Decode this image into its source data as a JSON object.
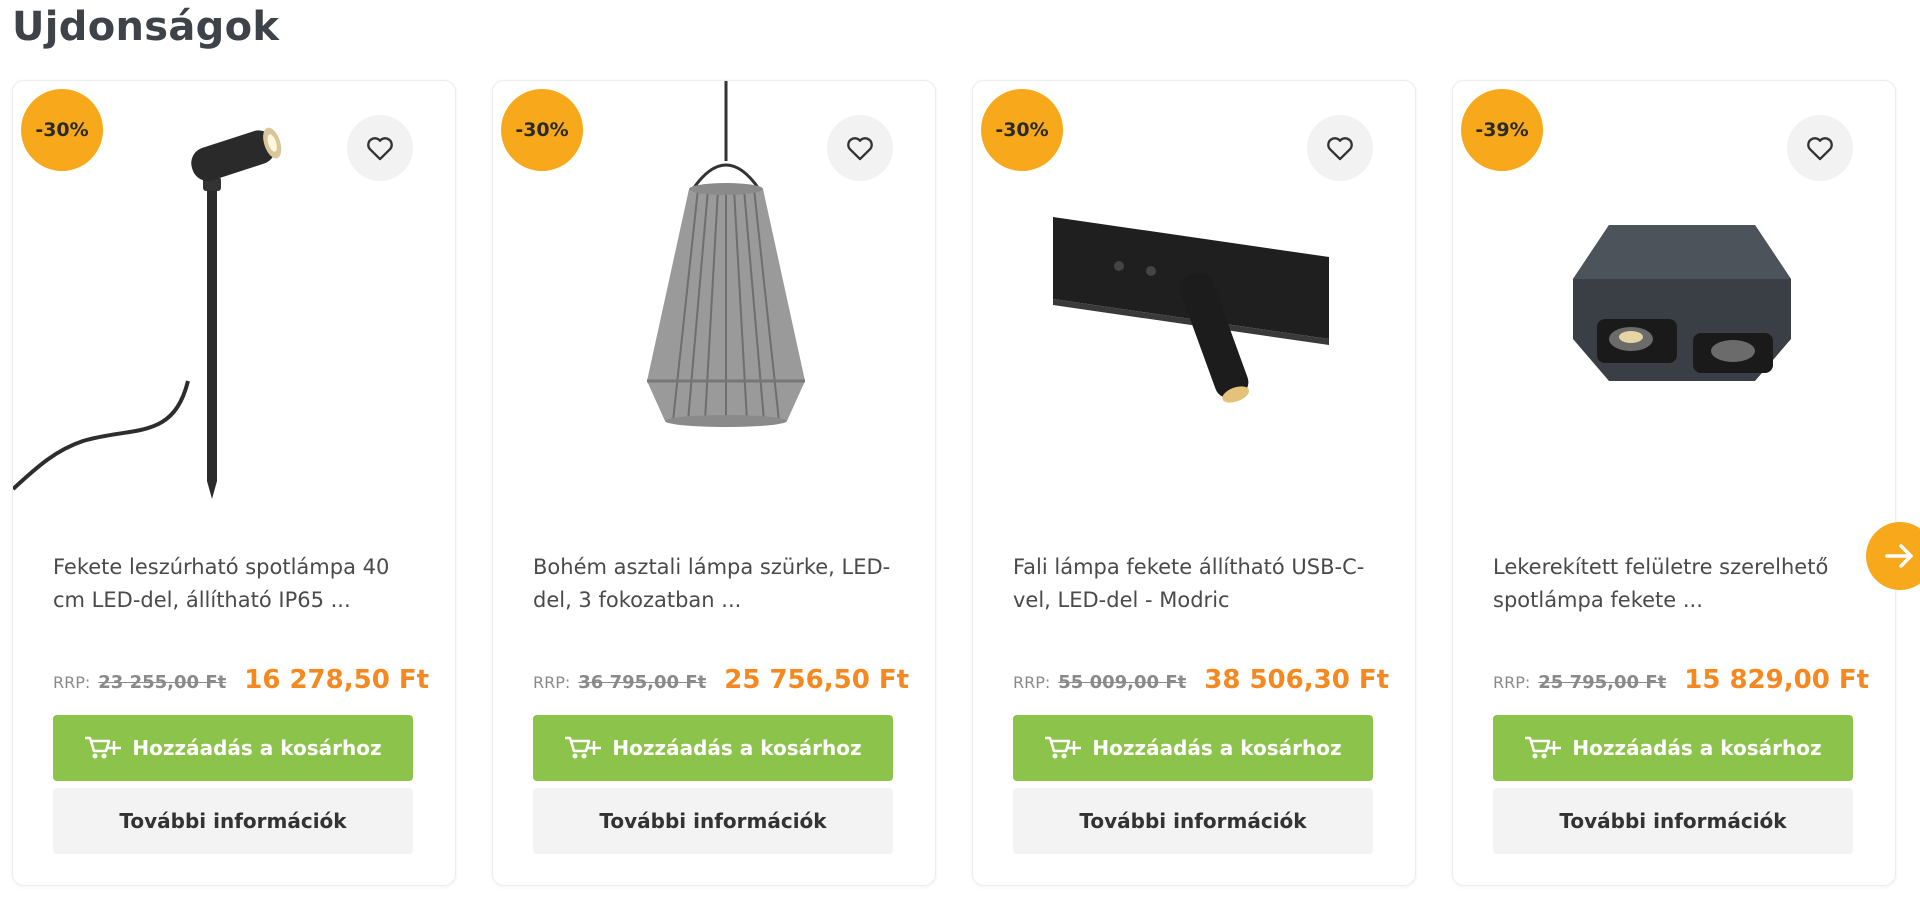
{
  "section": {
    "title": "Ujdonságok"
  },
  "colors": {
    "badge": "#f7a81b",
    "price": "#f5891f",
    "add_button": "#8cc34b",
    "info_button": "#f3f3f3"
  },
  "icons": {
    "wishlist": "heart-outline-icon",
    "cart": "cart-plus-icon",
    "next": "arrow-right-icon"
  },
  "products": [
    {
      "badge": "-30%",
      "title": "Fekete leszúrható spotlámpa 40 cm LED-del, állítható IP65 ...",
      "rrp_label": "RRP:",
      "rrp_price": "23 255,00 Ft",
      "price": "16 278,50 Ft",
      "add_label": "Hozzáadás a kosárhoz",
      "info_label": "További információk"
    },
    {
      "badge": "-30%",
      "title": "Bohém asztali lámpa szürke, LED-del, 3 fokozatban ...",
      "rrp_label": "RRP:",
      "rrp_price": "36 795,00 Ft",
      "price": "25 756,50 Ft",
      "add_label": "Hozzáadás a kosárhoz",
      "info_label": "További információk"
    },
    {
      "badge": "-30%",
      "title": "Fali lámpa fekete állítható USB-C-vel, LED-del - Modric",
      "rrp_label": "RRP:",
      "rrp_price": "55 009,00 Ft",
      "price": "38 506,30 Ft",
      "add_label": "Hozzáadás a kosárhoz",
      "info_label": "További információk"
    },
    {
      "badge": "-39%",
      "title": "Lekerekített felületre szerelhető spotlámpa fekete ...",
      "rrp_label": "RRP:",
      "rrp_price": "25 795,00 Ft",
      "price": "15 829,00 Ft",
      "add_label": "Hozzáadás a kosárhoz",
      "info_label": "További információk"
    }
  ]
}
